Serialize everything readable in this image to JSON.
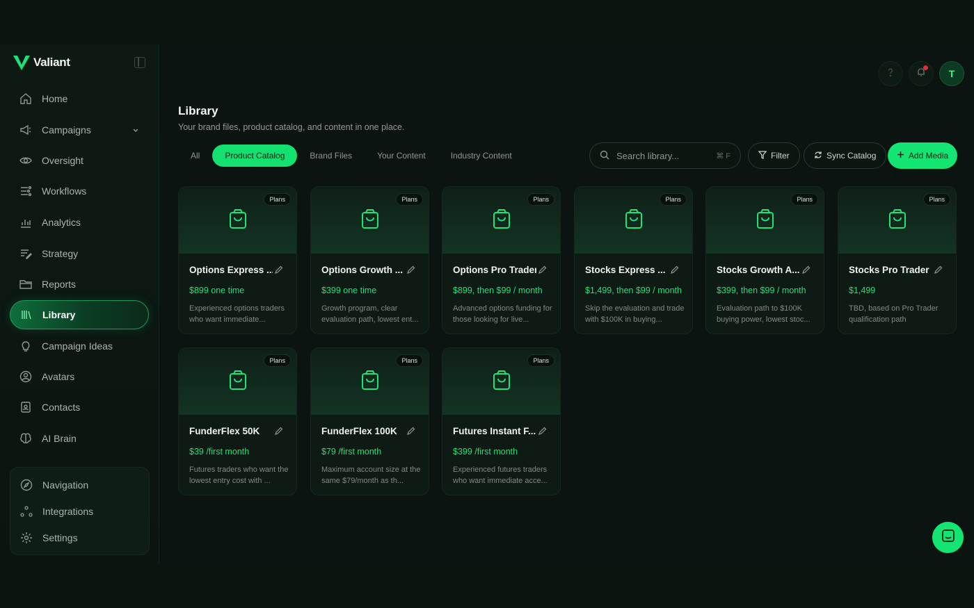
{
  "app": {
    "name": "Valiant"
  },
  "sidebar": {
    "items": [
      {
        "label": "Home",
        "icon": "home-icon"
      },
      {
        "label": "Campaigns",
        "icon": "megaphone-icon"
      },
      {
        "label": "Oversight",
        "icon": "eye-icon"
      },
      {
        "label": "Workflows",
        "icon": "workflow-icon"
      },
      {
        "label": "Analytics",
        "icon": "bar-chart-icon"
      },
      {
        "label": "Strategy",
        "icon": "strategy-icon"
      },
      {
        "label": "Reports",
        "icon": "folder-icon"
      },
      {
        "label": "Library",
        "icon": "library-icon",
        "active": true
      },
      {
        "label": "Campaign Ideas",
        "icon": "lightbulb-icon"
      },
      {
        "label": "Avatars",
        "icon": "user-circle-icon"
      },
      {
        "label": "Contacts",
        "icon": "contact-card-icon"
      },
      {
        "label": "AI Brain",
        "icon": "brain-icon"
      }
    ],
    "bottom": [
      {
        "label": "Navigation",
        "icon": "compass-icon"
      },
      {
        "label": "Integrations",
        "icon": "integrations-icon"
      },
      {
        "label": "Settings",
        "icon": "gear-icon"
      }
    ]
  },
  "header": {
    "avatar_initial": "T"
  },
  "page": {
    "title": "Library",
    "subtitle": "Your brand files, product catalog, and content in one place."
  },
  "tabs": [
    "All",
    "Product Catalog",
    "Brand Files",
    "Your Content",
    "Industry Content"
  ],
  "active_tab": "Product Catalog",
  "search": {
    "placeholder": "Search library...",
    "shortcut": "⌘ F"
  },
  "toolbar": {
    "filter_label": "Filter",
    "sync_label": "Sync Catalog",
    "add_label": "Add Media"
  },
  "cards": [
    {
      "badge": "Plans",
      "name": "Options Express ...",
      "price": "$899 one time",
      "desc": "Experienced options traders who want immediate..."
    },
    {
      "badge": "Plans",
      "name": "Options Growth ...",
      "price": "$399 one time",
      "desc": "Growth program, clear evaluation path, lowest ent..."
    },
    {
      "badge": "Plans",
      "name": "Options Pro Trader",
      "price": "$899, then $99 / month",
      "desc": "Advanced options funding for those looking for live..."
    },
    {
      "badge": "Plans",
      "name": "Stocks Express ...",
      "price": "$1,499, then $99 / month",
      "desc": "Skip the evaluation and trade with $100K in buying..."
    },
    {
      "badge": "Plans",
      "name": "Stocks Growth A...",
      "price": "$399, then $99 / month",
      "desc": "Evaluation path to $100K buying power, lowest stoc..."
    },
    {
      "badge": "Plans",
      "name": "Stocks Pro Trader",
      "price": "$1,499",
      "desc": "TBD, based on Pro Trader qualification path"
    },
    {
      "badge": "Plans",
      "name": "FunderFlex 50K",
      "price": "$39 /first month",
      "desc": "Futures traders who want the lowest entry cost with ..."
    },
    {
      "badge": "Plans",
      "name": "FunderFlex 100K",
      "price": "$79 /first month",
      "desc": "Maximum account size at the same $79/month as th..."
    },
    {
      "badge": "Plans",
      "name": "Futures Instant F...",
      "price": "$399 /first month",
      "desc": "Experienced futures traders who want immediate acce..."
    }
  ],
  "colors": {
    "accent": "#14e472",
    "background": "#0b1410",
    "notification": "#e62a3a"
  }
}
